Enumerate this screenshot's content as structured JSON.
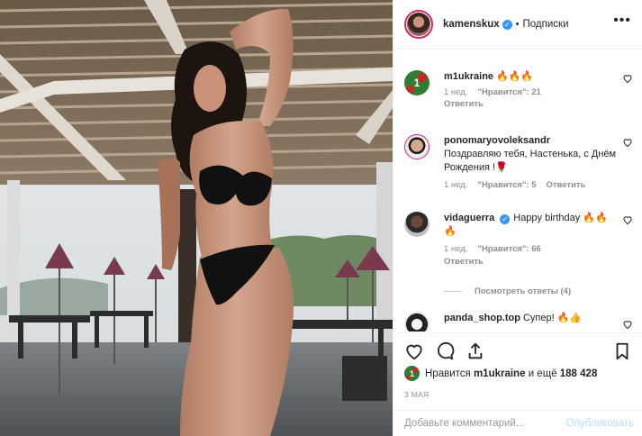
{
  "header": {
    "username": "kamenskux",
    "verified_glyph": "✓",
    "separator": "•",
    "follow_label": "Подписки",
    "more_label": "•••"
  },
  "comments": [
    {
      "avatar_text": "1",
      "username": "m1ukraine",
      "text": "🔥🔥🔥",
      "time": "1 нед.",
      "likes": "\"Нравится\": 21",
      "reply": "Ответить"
    },
    {
      "username": "ponomaryovoleksandr",
      "text": "Поздравляю тебя, Настенька, с Днём Рождения !🌹",
      "time": "1 нед.",
      "likes": "\"Нравится\": 5",
      "reply": "Ответить"
    },
    {
      "username": "vidaguerra",
      "text": "Happy birthday 🔥🔥🔥",
      "time": "1 нед.",
      "likes": "\"Нравится\": 66",
      "reply": "Ответить"
    },
    {
      "username": "panda_shop.top",
      "text": "Супер! 🔥👍"
    }
  ],
  "view_replies": "Посмотреть ответы (4)",
  "likes_row": {
    "avatar_text": "1",
    "prefix": "Нравится",
    "user": "m1ukraine",
    "suffix": "и ещё",
    "count": "188 428"
  },
  "date": "3 МАЯ",
  "add_comment": {
    "placeholder": "Добавьте комментарий...",
    "publish": "Опубликовать"
  },
  "icons": [
    "heart-icon",
    "comment-icon",
    "share-icon",
    "bookmark-icon",
    "more-icon",
    "verified-icon"
  ],
  "colors": {
    "verified": "#3897f0",
    "publish": "#b2dffc",
    "meta": "#8e8e8e",
    "avatar_ring": "#e0245e"
  }
}
